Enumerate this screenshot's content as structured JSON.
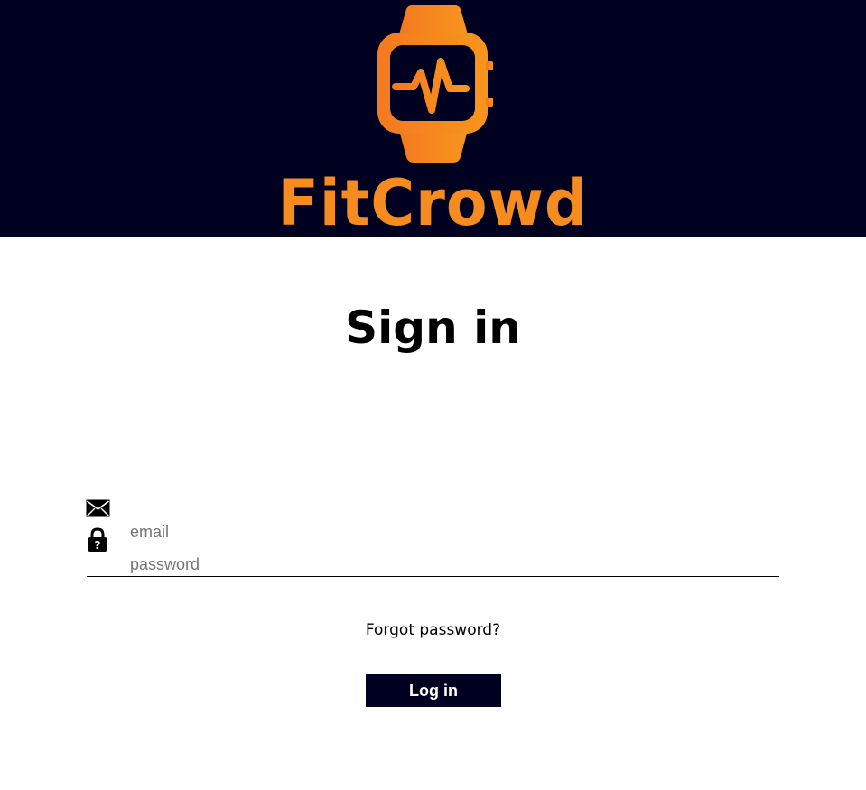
{
  "header": {
    "brand_name": "FitCrowd",
    "logo_icon": "smartwatch-heartbeat-icon",
    "background_color": "#000020",
    "accent_color": "#f68b1f"
  },
  "main": {
    "title": "Sign in",
    "email": {
      "icon": "envelope-icon",
      "placeholder": "email",
      "value": ""
    },
    "password": {
      "icon": "padlock-icon",
      "placeholder": "password",
      "value": ""
    },
    "forgot_password_label": "Forgot password?",
    "login_label": "Log in"
  }
}
